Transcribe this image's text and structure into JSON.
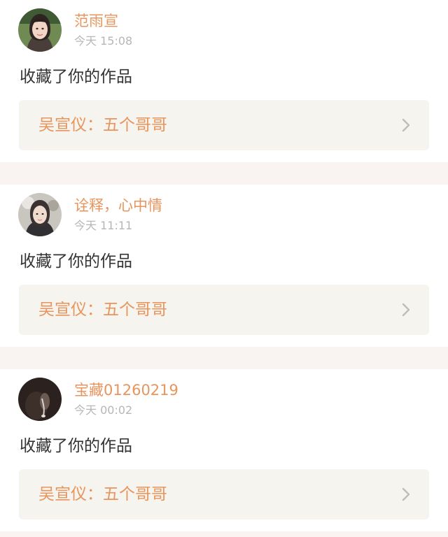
{
  "notifications": [
    {
      "username": "范雨宣",
      "time": "今天 15:08",
      "action": "收藏了你的作品",
      "work_title": "吴宣仪：五个哥哥",
      "avatar_icon": "person-photo-avatar"
    },
    {
      "username": "诠释，心中情",
      "time": "今天 11:11",
      "action": "收藏了你的作品",
      "work_title": "吴宣仪：五个哥哥",
      "avatar_icon": "person-photo-avatar"
    },
    {
      "username": "宝藏01260219",
      "time": "今天 00:02",
      "action": "收藏了你的作品",
      "work_title": "吴宣仪：五个哥哥",
      "avatar_icon": "person-photo-avatar"
    }
  ],
  "colors": {
    "accent": "#e8955d",
    "text": "#333333",
    "muted": "#b6b6b6",
    "link_bg": "#f5f4ef",
    "page_bg": "#f9f3f1"
  }
}
